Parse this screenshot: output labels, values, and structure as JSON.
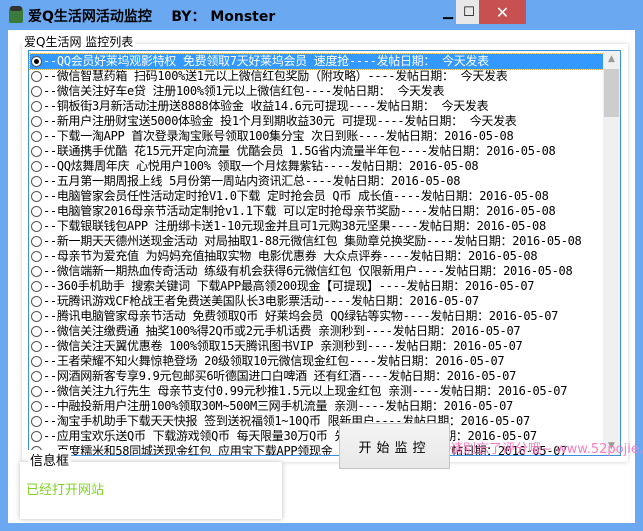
{
  "window": {
    "title": "爱Q生活网活动监控    BY： Monster",
    "min": "▁",
    "max": "☐",
    "close": "✕"
  },
  "list": {
    "label": "爱Q生活网 监控列表",
    "selected_index": 0,
    "items": [
      "--QQ会员好莱坞观影特权 免费领取7天好莱坞会员 速度抢----发帖日期：   今天发表",
      "--微信智慧药箱 扫码100%送1元以上微信红包奖励（附攻略）----发帖日期：   今天发表",
      "--微信关注好车e贷 注册100%领1元以上微信红包----发帖日期：   今天发表",
      "--铜板街3月新活动注册送8888体验金 收益14.6元可提现----发帖日期：   今天发表",
      "--新用户注册财宝送5000体验金 投1个月到期收益30元 可提现----发帖日期：   今天发表",
      "--下载一淘APP 首次登录淘宝账号领取100集分宝 次日到账----发帖日期：2016-05-08",
      "--联通携手优酷 花15元开定向流量 优酷会员 1.5G省内流量半年包----发帖日期：2016-05-08",
      "--QQ炫舞周年庆 心悦用户100% 领取一个月炫舞紫钻----发帖日期：2016-05-08",
      "--五月第一期周报上线 5月份第一周站内资讯汇总----发帖日期：2016-05-08",
      "--电脑管家会员任性活动定时抢V1.0下载 定时抢会员 Q币 成长值----发帖日期：2016-05-08",
      "--电脑管家2016母亲节活动定制抢v1.1下载 可以定时抢母亲节奖励----发帖日期：2016-05-08",
      "--下载银联钱包APP 注册绑卡送1-10元现金并且可1元购38元坚果----发帖日期：2016-05-08",
      "--新一期天天德州送现金活动 对局抽取1-88元微信红包 集勋章兑换奖励----发帖日期：2016-05-08",
      "--母亲节为爱充值 为妈妈充值抽取实物 电影优惠券 大众点评券----发帖日期：2016-05-08",
      "--微信端新一期热血传奇活动 练级有机会获得6元微信红包 仅限新用户----发帖日期：2016-05-08",
      "--360手机助手 搜索关键词 下载APP最高领200现金【可提现】----发帖日期：2016-05-07",
      "--玩腾讯游戏CF枪战王者免费送美国队长3电影票活动----发帖日期：2016-05-07",
      "--腾讯电脑管家母亲节活动 免费领取Q币 好莱坞会员 QQ绿钻等实物----发帖日期：2016-05-07",
      "--微信关注缴费通 抽奖100%得2Q币或2元手机话费 亲测秒到----发帖日期：2016-05-07",
      "--微信关注天翼优惠卷 100%领取15天腾讯图书VIP 亲测秒到----发帖日期：2016-05-07",
      "--王者荣耀不知火舞惊艳登场 20级领取10元微信现金红包----发帖日期：2016-05-07",
      "--网酒网新客专享9.9元包邮买6听德国进口白啤酒 还有红酒----发帖日期：2016-05-07",
      "--微信关注九行先生 母亲节支付0.99元秒推1.5元以上现金红包 亲测----发帖日期：2016-05-07",
      "--中融投新用户注册100%领取30M~500M三网手机流量 亲测----发帖日期：2016-05-07",
      "--淘宝手机助手下载天天快报 签到送祝福领1~10Q币 限新用户----发帖日期：2016-05-07",
      "--应用宝欢乐送Q币 下载游戏领Q币 每天限量30万Q币 先到先得----发帖日期：2016-05-07",
      "--百度糯米和58同城送现金红包 应用宝下载APP领现金 直接到QQ钱包----发帖日期：2016-05-07"
    ]
  },
  "watermark": "请别忘了评分哦~ www.52pojie.cn",
  "info": {
    "label": "信息框",
    "text": "已经打开网站"
  },
  "start_button": "开始监控",
  "colors": {
    "titlebar": "#6aa9f2",
    "selection": "#3399ff",
    "info_text": "#7ed321",
    "watermark": "#f57fc1",
    "close": "#c75050"
  }
}
